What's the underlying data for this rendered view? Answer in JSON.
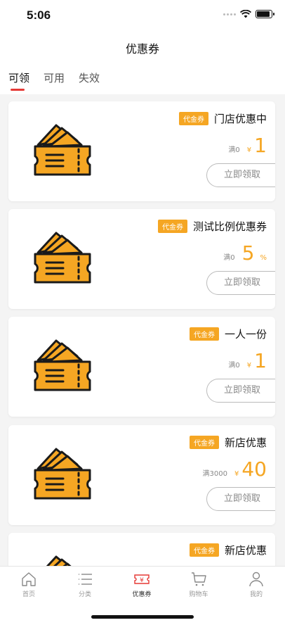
{
  "status_bar": {
    "time": "5:06",
    "battery_level": 0.9
  },
  "header": {
    "title": "优惠券"
  },
  "tabs": [
    {
      "label": "可领",
      "active": true
    },
    {
      "label": "可用",
      "active": false
    },
    {
      "label": "失效",
      "active": false
    }
  ],
  "coupons": [
    {
      "badge": "代金券",
      "name": "门店优惠中",
      "min": "满0",
      "prefix": "¥",
      "amount": "1",
      "suffix": "",
      "button": "立即领取"
    },
    {
      "badge": "代金券",
      "name": "测试比例优惠券",
      "min": "满0",
      "prefix": "",
      "amount": "5",
      "suffix": "%",
      "button": "立即领取"
    },
    {
      "badge": "代金券",
      "name": "一人一份",
      "min": "满0",
      "prefix": "¥",
      "amount": "1",
      "suffix": "",
      "button": "立即领取"
    },
    {
      "badge": "代金券",
      "name": "新店优惠",
      "min": "满3000",
      "prefix": "¥",
      "amount": "40",
      "suffix": "",
      "button": "立即领取"
    },
    {
      "badge": "代金券",
      "name": "新店优惠",
      "min": "",
      "prefix": "",
      "amount": "",
      "suffix": "",
      "button": ""
    }
  ],
  "tabbar": [
    {
      "label": "首页",
      "icon": "home-icon"
    },
    {
      "label": "分类",
      "icon": "list-icon"
    },
    {
      "label": "优惠券",
      "icon": "coupon-icon",
      "active": true
    },
    {
      "label": "购物车",
      "icon": "cart-icon"
    },
    {
      "label": "我的",
      "icon": "user-icon"
    }
  ],
  "colors": {
    "accent": "#f5a623",
    "tab_indicator": "#e53935",
    "ticket_fill": "#f5a623",
    "ticket_stroke": "#1a1a1a"
  }
}
